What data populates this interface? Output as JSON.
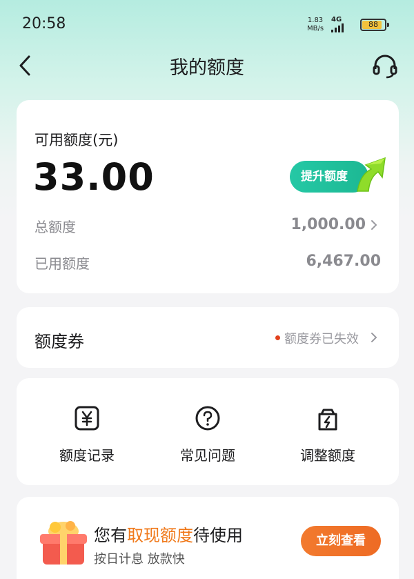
{
  "status_bar": {
    "time": "20:58",
    "net_speed_value": "1.83",
    "net_speed_unit": "MB/s",
    "network": "4G",
    "battery": "88",
    "battery_level": 0.88
  },
  "nav": {
    "title": "我的额度",
    "back_icon": "chevron-left-icon",
    "service_icon": "headset-icon"
  },
  "quota": {
    "available_label": "可用额度(元)",
    "available_amount": "33.00",
    "raise_button": "提升额度",
    "total_label": "总额度",
    "total_value": "1,000.00",
    "used_label": "已用额度",
    "used_value": "6,467.00"
  },
  "coupon": {
    "title": "额度券",
    "status": "额度券已失效"
  },
  "shortcuts": [
    {
      "label": "额度记录",
      "icon": "yen-record-icon"
    },
    {
      "label": "常见问题",
      "icon": "question-circle-icon"
    },
    {
      "label": "调整额度",
      "icon": "lightning-bag-icon"
    }
  ],
  "promo": {
    "title_prefix": "您有",
    "title_highlight": "取现额度",
    "title_suffix": "待使用",
    "subtitle": "按日计息 放款快",
    "button": "立刻查看",
    "icon": "gift-box-icon"
  },
  "colors": {
    "accent_green": "#1cb893",
    "accent_orange": "#f07a1c",
    "status_dot": "#e2401c"
  }
}
